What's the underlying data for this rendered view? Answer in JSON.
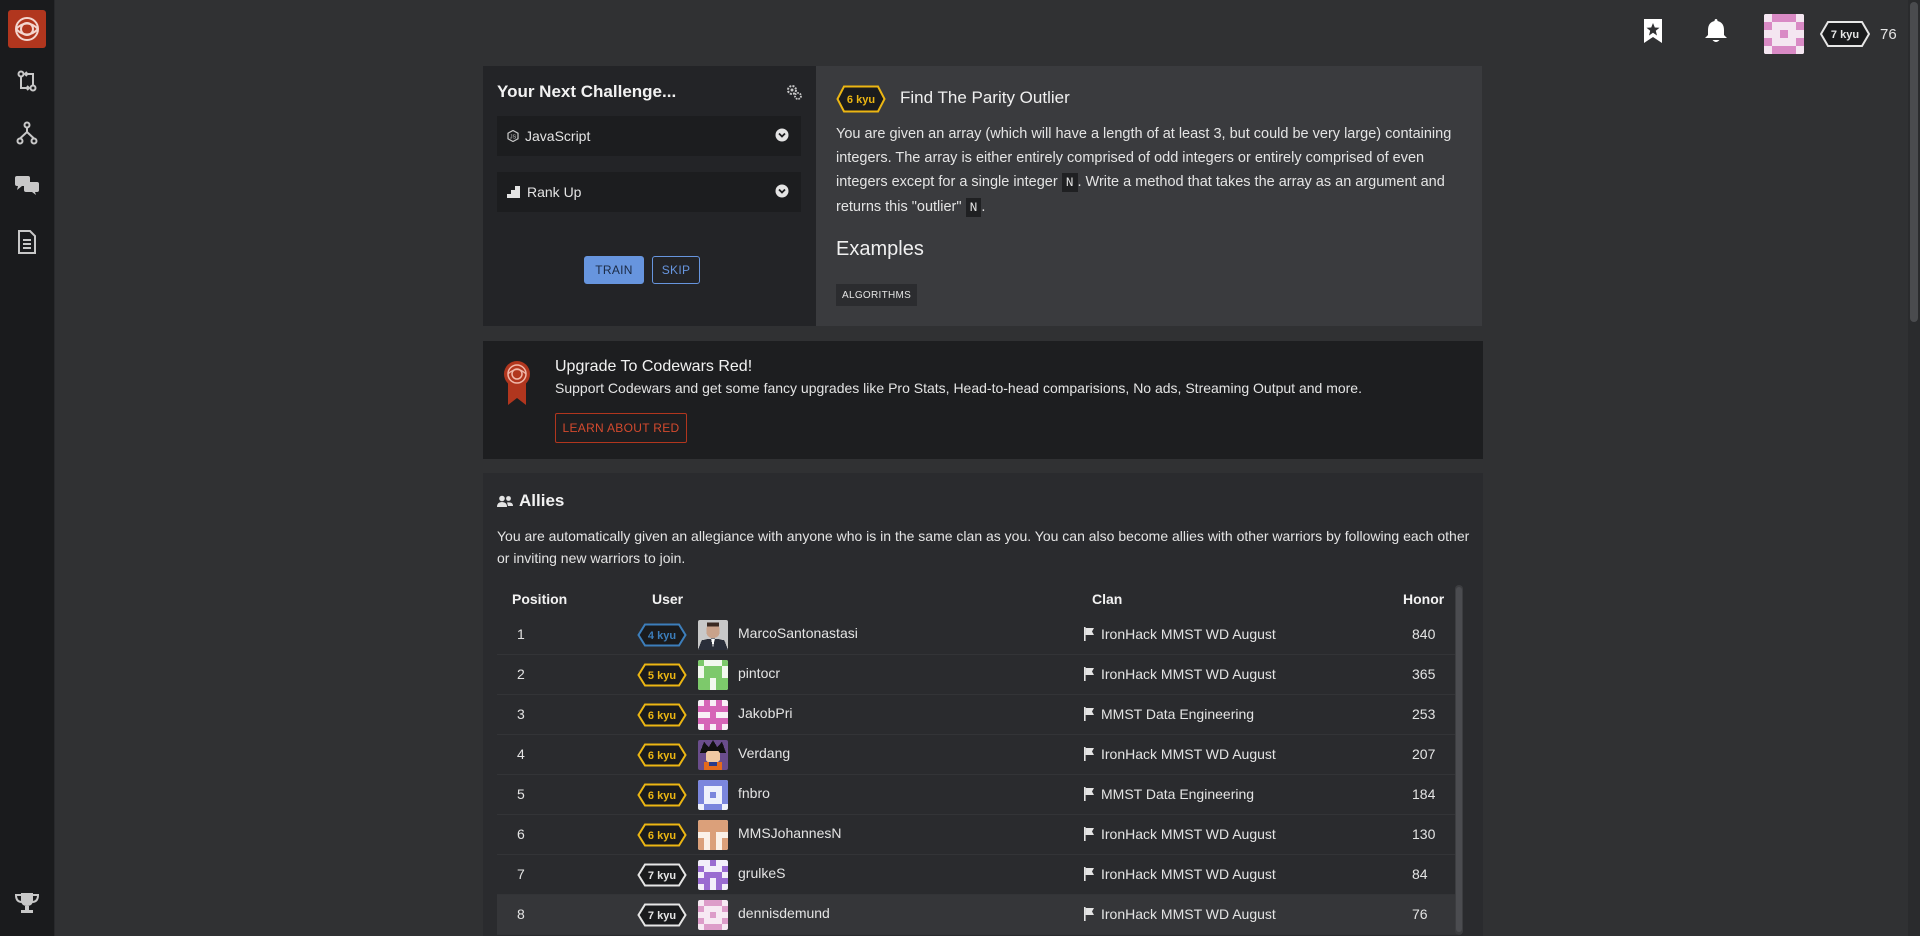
{
  "sidebar": {
    "items": [
      {
        "name": "practice-icon"
      },
      {
        "name": "fork-icon"
      },
      {
        "name": "discuss-icon"
      },
      {
        "name": "docs-icon"
      },
      {
        "name": "leaderboard-trophy-icon"
      }
    ]
  },
  "topbar": {
    "rank": "7 kyu",
    "honor": "76"
  },
  "next_challenge": {
    "heading": "Your Next Challenge...",
    "language": "JavaScript",
    "strategy": "Rank Up",
    "train_label": "TRAIN",
    "skip_label": "SKIP"
  },
  "kata": {
    "rank": "6 kyu",
    "title": "Find The Parity Outlier",
    "desc_1": "You are given an array (which will have a length of at least 3, but could be very large) containing integers. The array is either entirely comprised of odd integers or entirely comprised of even integers except for a single integer ",
    "code_n": "N",
    "desc_2": ". Write a method that takes the array as an argument and returns this \"outlier\" ",
    "desc_3": ".",
    "examples_heading": "Examples",
    "tag": "ALGORITHMS"
  },
  "upgrade": {
    "title": "Upgrade To Codewars Red!",
    "text": "Support Codewars and get some fancy upgrades like Pro Stats, Head-to-head comparisions, No ads, Streaming Output and more.",
    "button": "LEARN ABOUT RED"
  },
  "allies": {
    "title": "Allies",
    "intro": "You are automatically given an allegiance with anyone who is in the same clan as you. You can also become allies with other warriors by following each other or inviting new warriors to join.",
    "columns": {
      "position": "Position",
      "user": "User",
      "clan": "Clan",
      "honor": "Honor"
    },
    "rows": [
      {
        "position": "1",
        "rank": "4 kyu",
        "rank_color": "#3c7ebb",
        "user": "MarcoSantonastasi",
        "avatar": "photo-suit",
        "clan": "IronHack MMST WD August",
        "honor": "840"
      },
      {
        "position": "2",
        "rank": "5 kyu",
        "rank_color": "#ecb613",
        "user": "pintocr",
        "avatar": "identicon-green",
        "clan": "IronHack MMST WD August",
        "honor": "365"
      },
      {
        "position": "3",
        "rank": "6 kyu",
        "rank_color": "#ecb613",
        "user": "JakobPri",
        "avatar": "identicon-pink",
        "clan": "MMST Data Engineering",
        "honor": "253"
      },
      {
        "position": "4",
        "rank": "6 kyu",
        "rank_color": "#ecb613",
        "user": "Verdang",
        "avatar": "anime-character",
        "clan": "IronHack MMST WD August",
        "honor": "207"
      },
      {
        "position": "5",
        "rank": "6 kyu",
        "rank_color": "#ecb613",
        "user": "fnbro",
        "avatar": "identicon-blue",
        "clan": "MMST Data Engineering",
        "honor": "184"
      },
      {
        "position": "6",
        "rank": "6 kyu",
        "rank_color": "#ecb613",
        "user": "MMSJohannesN",
        "avatar": "identicon-tan",
        "clan": "IronHack MMST WD August",
        "honor": "130"
      },
      {
        "position": "7",
        "rank": "7 kyu",
        "rank_color": "#e6e6e6",
        "user": "grulkeS",
        "avatar": "identicon-purple",
        "clan": "IronHack MMST WD August",
        "honor": "84"
      },
      {
        "position": "8",
        "rank": "7 kyu",
        "rank_color": "#e6e6e6",
        "user": "dennisdemund",
        "avatar": "identicon-lightpink",
        "clan": "IronHack MMST WD August",
        "honor": "76"
      }
    ]
  },
  "colors": {
    "brand_red": "#b1361e",
    "kyu_yellow": "#ecb613",
    "kyu_blue": "#3c7ebb",
    "kyu_white": "#e6e6e6",
    "train_blue": "#6795de"
  }
}
